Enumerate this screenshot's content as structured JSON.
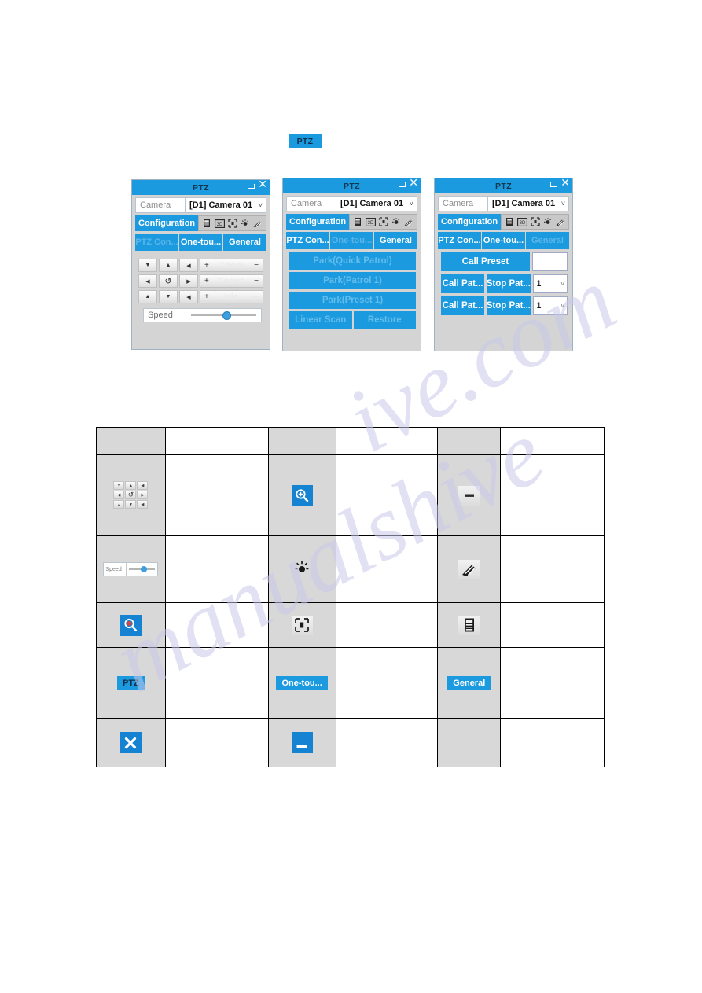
{
  "document": {
    "watermark_text_a": "manualshive",
    "watermark_text_b": "ive.com"
  },
  "top_button": {
    "label": "PTZ",
    "name": "ptz-toolbar-button"
  },
  "panels": [
    {
      "id": "panel-ptz-control",
      "title": "PTZ",
      "camera": {
        "label": "Camera",
        "value": "[D1] Camera 01",
        "chevron": "˅"
      },
      "configuration": {
        "label": "Configuration"
      },
      "config_icons": [
        "menu-icon",
        "3d-positioning-icon",
        "center-frame-icon",
        "light-icon",
        "wiper-icon"
      ],
      "tabs": [
        {
          "label": "PTZ Con...",
          "state": "active"
        },
        {
          "label": "One-tou...",
          "state": "normal"
        },
        {
          "label": "General",
          "state": "normal"
        }
      ],
      "dpad": {
        "rows": [
          [
            "▼",
            "▲",
            "◀"
          ],
          [
            "◀",
            "↺",
            "▶"
          ],
          [
            "▲",
            "▼",
            "◀"
          ]
        ],
        "controls": [
          {
            "label": "Zoom",
            "plus": "+",
            "minus": "−"
          },
          {
            "label": "Focus",
            "plus": "+",
            "minus": "−"
          },
          {
            "label": "Iris",
            "plus": "+",
            "minus": "−"
          }
        ]
      },
      "speed": {
        "label": "Speed",
        "value": 50
      }
    },
    {
      "id": "panel-one-touch",
      "title": "PTZ",
      "camera": {
        "label": "Camera",
        "value": "[D1] Camera 01",
        "chevron": "˅"
      },
      "configuration": {
        "label": "Configuration"
      },
      "config_icons": [
        "menu-icon",
        "3d-positioning-icon",
        "center-frame-icon",
        "light-icon",
        "wiper-icon"
      ],
      "tabs": [
        {
          "label": "PTZ Con...",
          "state": "normal"
        },
        {
          "label": "One-tou...",
          "state": "active"
        },
        {
          "label": "General",
          "state": "normal"
        }
      ],
      "buttons": [
        "Park(Quick Patrol)",
        "Park(Patrol 1)",
        "Park(Preset 1)"
      ],
      "button_pair": [
        "Linear Scan",
        "Restore"
      ]
    },
    {
      "id": "panel-general",
      "title": "PTZ",
      "camera": {
        "label": "Camera",
        "value": "[D1] Camera 01",
        "chevron": "˅"
      },
      "configuration": {
        "label": "Configuration"
      },
      "config_icons": [
        "menu-icon",
        "3d-positioning-icon",
        "center-frame-icon",
        "light-icon",
        "wiper-icon"
      ],
      "tabs": [
        {
          "label": "PTZ Con...",
          "state": "normal"
        },
        {
          "label": "One-tou...",
          "state": "normal"
        },
        {
          "label": "General",
          "state": "active"
        }
      ],
      "rows": [
        {
          "primary": "Call Preset",
          "secondary": "",
          "field_type": "input",
          "field_value": ""
        },
        {
          "primary": "Call Pat...",
          "secondary": "Stop Pat...",
          "field_type": "select",
          "field_value": "1",
          "chevron": "˅"
        },
        {
          "primary": "Call Pat...",
          "secondary": "Stop Pat...",
          "field_type": "select",
          "field_value": "1",
          "chevron": "˅"
        }
      ]
    }
  ],
  "legend_table": {
    "rows": [
      {
        "cells": [
          {
            "type": "icon",
            "icon": "",
            "text": ""
          },
          {
            "type": "desc",
            "text": ""
          },
          {
            "type": "icon",
            "icon": "",
            "text": ""
          },
          {
            "type": "desc",
            "text": ""
          },
          {
            "type": "icon",
            "icon": "",
            "text": ""
          },
          {
            "type": "desc",
            "text": ""
          }
        ]
      },
      {
        "cells": [
          {
            "type": "icon",
            "icon": "direction-pad-icon",
            "text": ""
          },
          {
            "type": "desc",
            "text": ""
          },
          {
            "type": "icon",
            "icon": "zoom-in-icon",
            "text": ""
          },
          {
            "type": "desc",
            "text": ""
          },
          {
            "type": "icon",
            "icon": "minus-button-icon",
            "text": ""
          },
          {
            "type": "desc",
            "text": ""
          }
        ]
      },
      {
        "cells": [
          {
            "type": "icon",
            "icon": "speed-slider-icon",
            "text": ""
          },
          {
            "type": "desc",
            "text": ""
          },
          {
            "type": "icon",
            "icon": "light-icon",
            "text": ""
          },
          {
            "type": "desc",
            "text": ""
          },
          {
            "type": "icon",
            "icon": "wiper-icon",
            "text": ""
          },
          {
            "type": "desc",
            "text": ""
          }
        ]
      },
      {
        "cells": [
          {
            "type": "icon",
            "icon": "zoom-search-icon",
            "text": ""
          },
          {
            "type": "desc",
            "text": ""
          },
          {
            "type": "icon",
            "icon": "center-frame-icon",
            "text": ""
          },
          {
            "type": "desc",
            "text": ""
          },
          {
            "type": "icon",
            "icon": "menu-icon",
            "text": ""
          },
          {
            "type": "desc",
            "text": ""
          }
        ]
      },
      {
        "cells": [
          {
            "type": "icon",
            "icon": "ptz-chip",
            "text": "PTZ"
          },
          {
            "type": "desc",
            "text": ""
          },
          {
            "type": "icon",
            "icon": "one-touch-chip",
            "text": "One-tou..."
          },
          {
            "type": "desc",
            "text": ""
          },
          {
            "type": "icon",
            "icon": "general-chip",
            "text": "General"
          },
          {
            "type": "desc",
            "text": ""
          }
        ]
      },
      {
        "cells": [
          {
            "type": "icon",
            "icon": "close-icon",
            "text": ""
          },
          {
            "type": "desc",
            "text": ""
          },
          {
            "type": "icon",
            "icon": "minimize-icon",
            "text": ""
          },
          {
            "type": "desc",
            "text": ""
          },
          {
            "type": "icon",
            "icon": "",
            "text": ""
          },
          {
            "type": "desc",
            "text": ""
          }
        ]
      }
    ]
  }
}
